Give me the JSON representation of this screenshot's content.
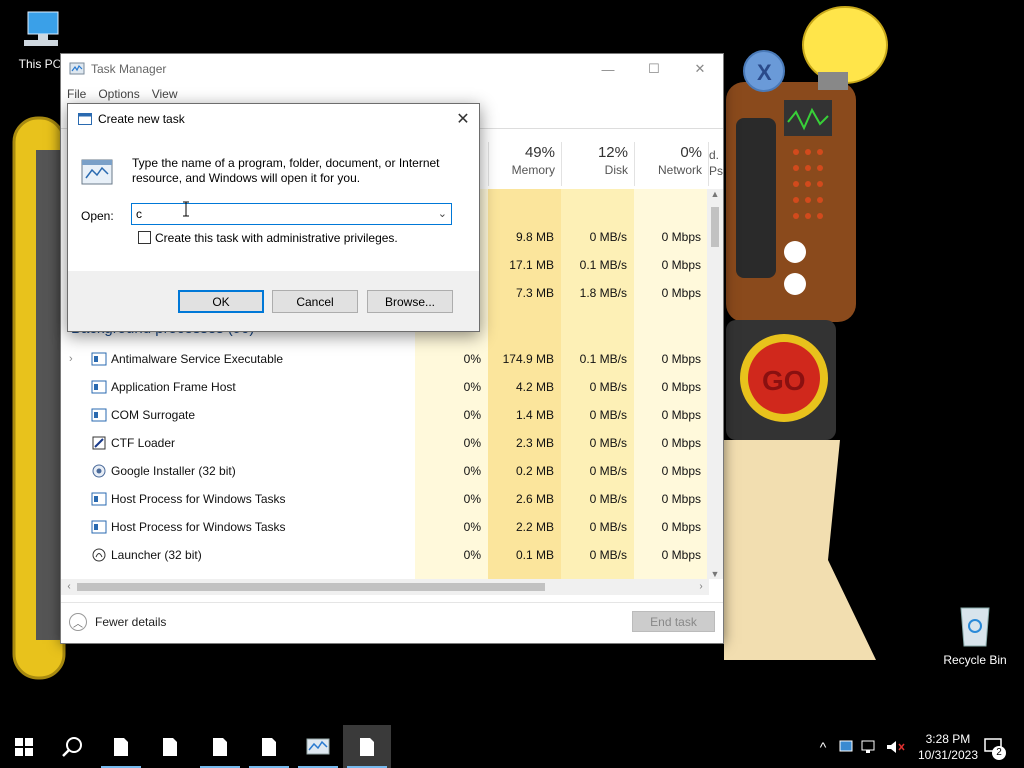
{
  "desktop": {
    "icons": [
      {
        "label": "This PC"
      },
      {
        "label": "Recycle Bin"
      }
    ]
  },
  "task_manager": {
    "title": "Task Manager",
    "menu": [
      "File",
      "Options",
      "View"
    ],
    "columns": [
      {
        "pct": "49%",
        "name": "Memory"
      },
      {
        "pct": "12%",
        "name": "Disk"
      },
      {
        "pct": "0%",
        "name": "Network"
      },
      {
        "pct": "d.",
        "name": "Ps"
      }
    ],
    "top_rows": [
      {
        "memory": "9.8 MB",
        "disk": "0 MB/s",
        "network": "0 Mbps"
      },
      {
        "memory": "17.1 MB",
        "disk": "0.1 MB/s",
        "network": "0 Mbps"
      },
      {
        "memory": "7.3 MB",
        "disk": "1.8 MB/s",
        "network": "0 Mbps"
      }
    ],
    "section_header": "Background processes (90)",
    "processes": [
      {
        "name": "Antimalware Service Executable",
        "cpu": "0%",
        "memory": "174.9 MB",
        "disk": "0.1 MB/s",
        "network": "0 Mbps",
        "icon": "service-icon",
        "expandable": true
      },
      {
        "name": "Application Frame Host",
        "cpu": "0%",
        "memory": "4.2 MB",
        "disk": "0 MB/s",
        "network": "0 Mbps",
        "icon": "service-icon",
        "expandable": false
      },
      {
        "name": "COM Surrogate",
        "cpu": "0%",
        "memory": "1.4 MB",
        "disk": "0 MB/s",
        "network": "0 Mbps",
        "icon": "service-icon",
        "expandable": false
      },
      {
        "name": "CTF Loader",
        "cpu": "0%",
        "memory": "2.3 MB",
        "disk": "0 MB/s",
        "network": "0 Mbps",
        "icon": "ctf-icon",
        "expandable": false
      },
      {
        "name": "Google Installer (32 bit)",
        "cpu": "0%",
        "memory": "0.2 MB",
        "disk": "0 MB/s",
        "network": "0 Mbps",
        "icon": "google-installer-icon",
        "expandable": false
      },
      {
        "name": "Host Process for Windows Tasks",
        "cpu": "0%",
        "memory": "2.6 MB",
        "disk": "0 MB/s",
        "network": "0 Mbps",
        "icon": "service-icon",
        "expandable": false
      },
      {
        "name": "Host Process for Windows Tasks",
        "cpu": "0%",
        "memory": "2.2 MB",
        "disk": "0 MB/s",
        "network": "0 Mbps",
        "icon": "service-icon",
        "expandable": false
      },
      {
        "name": "Launcher (32 bit)",
        "cpu": "0%",
        "memory": "0.1 MB",
        "disk": "0 MB/s",
        "network": "0 Mbps",
        "icon": "launcher-icon",
        "expandable": false
      }
    ],
    "footer": {
      "fewer_details": "Fewer details",
      "end_task": "End task"
    }
  },
  "dialog": {
    "title": "Create new task",
    "description": "Type the name of a program, folder, document, or Internet resource, and Windows will open it for you.",
    "open_label": "Open:",
    "open_value": "c",
    "admin_checkbox_label": "Create this task with administrative privileges.",
    "admin_checked": false,
    "buttons": {
      "ok": "OK",
      "cancel": "Cancel",
      "browse": "Browse..."
    }
  },
  "taskbar": {
    "clock_time": "3:28 PM",
    "clock_date": "10/31/2023",
    "notification_count": "2"
  },
  "colors": {
    "accent": "#0078d7",
    "highlight_light": "#fff9db",
    "highlight_mid": "#fdf0b6",
    "highlight_strong": "#fbe59c"
  }
}
